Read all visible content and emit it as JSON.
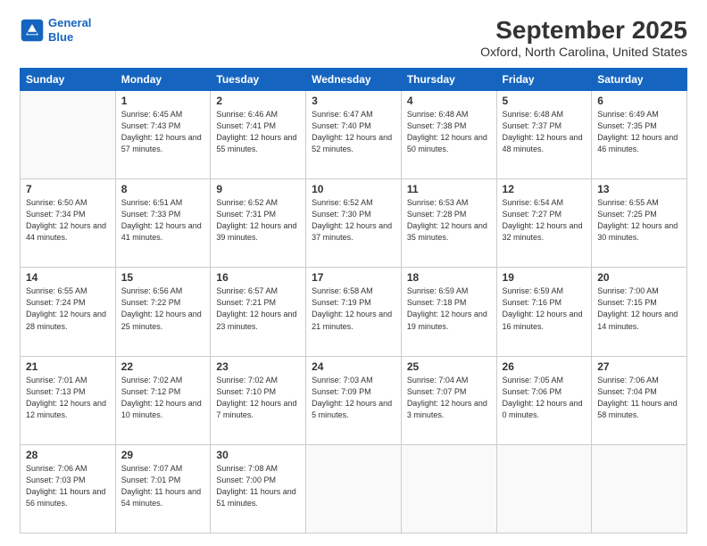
{
  "logo": {
    "line1": "General",
    "line2": "Blue"
  },
  "title": "September 2025",
  "subtitle": "Oxford, North Carolina, United States",
  "headers": [
    "Sunday",
    "Monday",
    "Tuesday",
    "Wednesday",
    "Thursday",
    "Friday",
    "Saturday"
  ],
  "weeks": [
    [
      {
        "day": "",
        "sunrise": "",
        "sunset": "",
        "daylight": ""
      },
      {
        "day": "1",
        "sunrise": "Sunrise: 6:45 AM",
        "sunset": "Sunset: 7:43 PM",
        "daylight": "Daylight: 12 hours and 57 minutes."
      },
      {
        "day": "2",
        "sunrise": "Sunrise: 6:46 AM",
        "sunset": "Sunset: 7:41 PM",
        "daylight": "Daylight: 12 hours and 55 minutes."
      },
      {
        "day": "3",
        "sunrise": "Sunrise: 6:47 AM",
        "sunset": "Sunset: 7:40 PM",
        "daylight": "Daylight: 12 hours and 52 minutes."
      },
      {
        "day": "4",
        "sunrise": "Sunrise: 6:48 AM",
        "sunset": "Sunset: 7:38 PM",
        "daylight": "Daylight: 12 hours and 50 minutes."
      },
      {
        "day": "5",
        "sunrise": "Sunrise: 6:48 AM",
        "sunset": "Sunset: 7:37 PM",
        "daylight": "Daylight: 12 hours and 48 minutes."
      },
      {
        "day": "6",
        "sunrise": "Sunrise: 6:49 AM",
        "sunset": "Sunset: 7:35 PM",
        "daylight": "Daylight: 12 hours and 46 minutes."
      }
    ],
    [
      {
        "day": "7",
        "sunrise": "Sunrise: 6:50 AM",
        "sunset": "Sunset: 7:34 PM",
        "daylight": "Daylight: 12 hours and 44 minutes."
      },
      {
        "day": "8",
        "sunrise": "Sunrise: 6:51 AM",
        "sunset": "Sunset: 7:33 PM",
        "daylight": "Daylight: 12 hours and 41 minutes."
      },
      {
        "day": "9",
        "sunrise": "Sunrise: 6:52 AM",
        "sunset": "Sunset: 7:31 PM",
        "daylight": "Daylight: 12 hours and 39 minutes."
      },
      {
        "day": "10",
        "sunrise": "Sunrise: 6:52 AM",
        "sunset": "Sunset: 7:30 PM",
        "daylight": "Daylight: 12 hours and 37 minutes."
      },
      {
        "day": "11",
        "sunrise": "Sunrise: 6:53 AM",
        "sunset": "Sunset: 7:28 PM",
        "daylight": "Daylight: 12 hours and 35 minutes."
      },
      {
        "day": "12",
        "sunrise": "Sunrise: 6:54 AM",
        "sunset": "Sunset: 7:27 PM",
        "daylight": "Daylight: 12 hours and 32 minutes."
      },
      {
        "day": "13",
        "sunrise": "Sunrise: 6:55 AM",
        "sunset": "Sunset: 7:25 PM",
        "daylight": "Daylight: 12 hours and 30 minutes."
      }
    ],
    [
      {
        "day": "14",
        "sunrise": "Sunrise: 6:55 AM",
        "sunset": "Sunset: 7:24 PM",
        "daylight": "Daylight: 12 hours and 28 minutes."
      },
      {
        "day": "15",
        "sunrise": "Sunrise: 6:56 AM",
        "sunset": "Sunset: 7:22 PM",
        "daylight": "Daylight: 12 hours and 25 minutes."
      },
      {
        "day": "16",
        "sunrise": "Sunrise: 6:57 AM",
        "sunset": "Sunset: 7:21 PM",
        "daylight": "Daylight: 12 hours and 23 minutes."
      },
      {
        "day": "17",
        "sunrise": "Sunrise: 6:58 AM",
        "sunset": "Sunset: 7:19 PM",
        "daylight": "Daylight: 12 hours and 21 minutes."
      },
      {
        "day": "18",
        "sunrise": "Sunrise: 6:59 AM",
        "sunset": "Sunset: 7:18 PM",
        "daylight": "Daylight: 12 hours and 19 minutes."
      },
      {
        "day": "19",
        "sunrise": "Sunrise: 6:59 AM",
        "sunset": "Sunset: 7:16 PM",
        "daylight": "Daylight: 12 hours and 16 minutes."
      },
      {
        "day": "20",
        "sunrise": "Sunrise: 7:00 AM",
        "sunset": "Sunset: 7:15 PM",
        "daylight": "Daylight: 12 hours and 14 minutes."
      }
    ],
    [
      {
        "day": "21",
        "sunrise": "Sunrise: 7:01 AM",
        "sunset": "Sunset: 7:13 PM",
        "daylight": "Daylight: 12 hours and 12 minutes."
      },
      {
        "day": "22",
        "sunrise": "Sunrise: 7:02 AM",
        "sunset": "Sunset: 7:12 PM",
        "daylight": "Daylight: 12 hours and 10 minutes."
      },
      {
        "day": "23",
        "sunrise": "Sunrise: 7:02 AM",
        "sunset": "Sunset: 7:10 PM",
        "daylight": "Daylight: 12 hours and 7 minutes."
      },
      {
        "day": "24",
        "sunrise": "Sunrise: 7:03 AM",
        "sunset": "Sunset: 7:09 PM",
        "daylight": "Daylight: 12 hours and 5 minutes."
      },
      {
        "day": "25",
        "sunrise": "Sunrise: 7:04 AM",
        "sunset": "Sunset: 7:07 PM",
        "daylight": "Daylight: 12 hours and 3 minutes."
      },
      {
        "day": "26",
        "sunrise": "Sunrise: 7:05 AM",
        "sunset": "Sunset: 7:06 PM",
        "daylight": "Daylight: 12 hours and 0 minutes."
      },
      {
        "day": "27",
        "sunrise": "Sunrise: 7:06 AM",
        "sunset": "Sunset: 7:04 PM",
        "daylight": "Daylight: 11 hours and 58 minutes."
      }
    ],
    [
      {
        "day": "28",
        "sunrise": "Sunrise: 7:06 AM",
        "sunset": "Sunset: 7:03 PM",
        "daylight": "Daylight: 11 hours and 56 minutes."
      },
      {
        "day": "29",
        "sunrise": "Sunrise: 7:07 AM",
        "sunset": "Sunset: 7:01 PM",
        "daylight": "Daylight: 11 hours and 54 minutes."
      },
      {
        "day": "30",
        "sunrise": "Sunrise: 7:08 AM",
        "sunset": "Sunset: 7:00 PM",
        "daylight": "Daylight: 11 hours and 51 minutes."
      },
      {
        "day": "",
        "sunrise": "",
        "sunset": "",
        "daylight": ""
      },
      {
        "day": "",
        "sunrise": "",
        "sunset": "",
        "daylight": ""
      },
      {
        "day": "",
        "sunrise": "",
        "sunset": "",
        "daylight": ""
      },
      {
        "day": "",
        "sunrise": "",
        "sunset": "",
        "daylight": ""
      }
    ]
  ]
}
